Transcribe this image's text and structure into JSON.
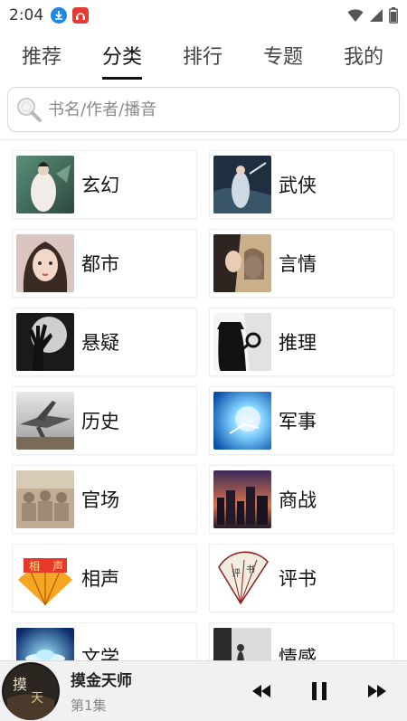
{
  "status_bar": {
    "time": "2:04",
    "icons": [
      "download-notification-icon",
      "app-notification-icon",
      "wifi-icon",
      "cell-signal-icon",
      "battery-icon"
    ]
  },
  "tabs": [
    {
      "label": "推荐",
      "active": false
    },
    {
      "label": "分类",
      "active": true
    },
    {
      "label": "排行",
      "active": false
    },
    {
      "label": "专题",
      "active": false
    },
    {
      "label": "我的",
      "active": false
    }
  ],
  "search": {
    "placeholder": "书名/作者/播音",
    "icon": "search-icon"
  },
  "categories": [
    {
      "label": "玄幻",
      "thumb": "fantasy-thumbnail"
    },
    {
      "label": "武侠",
      "thumb": "wuxia-thumbnail"
    },
    {
      "label": "都市",
      "thumb": "city-thumbnail"
    },
    {
      "label": "言情",
      "thumb": "romance-thumbnail"
    },
    {
      "label": "悬疑",
      "thumb": "suspense-thumbnail"
    },
    {
      "label": "推理",
      "thumb": "mystery-thumbnail"
    },
    {
      "label": "历史",
      "thumb": "history-thumbnail"
    },
    {
      "label": "军事",
      "thumb": "military-thumbnail"
    },
    {
      "label": "官场",
      "thumb": "officialdom-thumbnail"
    },
    {
      "label": "商战",
      "thumb": "business-thumbnail"
    },
    {
      "label": "相声",
      "thumb": "crosstalk-thumbnail"
    },
    {
      "label": "评书",
      "thumb": "storytelling-thumbnail"
    },
    {
      "label": "文学",
      "thumb": "literature-thumbnail"
    },
    {
      "label": "情感",
      "thumb": "emotion-thumbnail"
    }
  ],
  "player": {
    "title": "摸金天师",
    "episode": "第1集",
    "cover": "album-cover",
    "controls": [
      "previous-icon",
      "pause-icon",
      "next-icon"
    ]
  },
  "colors": {
    "accent": "#111111",
    "download_icon": "#1e88e5",
    "app_icon": "#e53935",
    "player_bg": "#f1f1f1"
  }
}
